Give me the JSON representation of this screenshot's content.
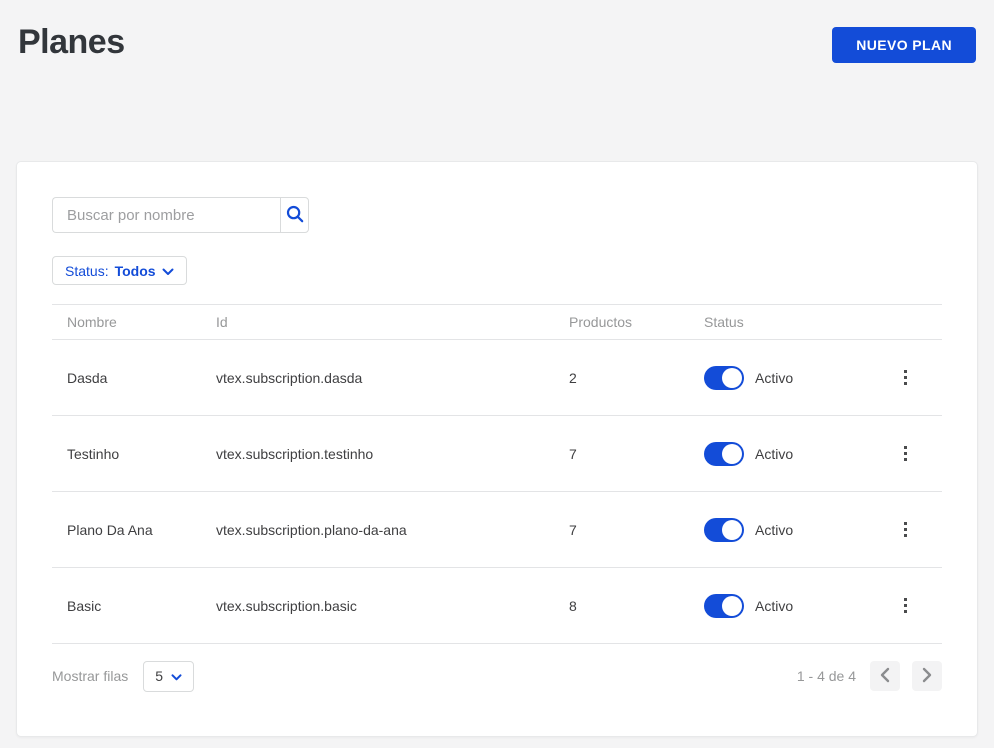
{
  "page": {
    "title": "Planes"
  },
  "header": {
    "new_plan_button": "NUEVO PLAN"
  },
  "toolbar": {
    "search": {
      "placeholder": "Buscar por nombre"
    },
    "status_filter": {
      "label": "Status:",
      "value": "Todos"
    }
  },
  "table": {
    "columns": [
      "Nombre",
      "Id",
      "Productos",
      "Status"
    ],
    "rows": [
      {
        "nombre": "Dasda",
        "id": "vtex.subscription.dasda",
        "productos": "2",
        "status_label": "Activo",
        "active": true
      },
      {
        "nombre": "Testinho",
        "id": "vtex.subscription.testinho",
        "productos": "7",
        "status_label": "Activo",
        "active": true
      },
      {
        "nombre": "Plano Da Ana",
        "id": "vtex.subscription.plano-da-ana",
        "productos": "7",
        "status_label": "Activo",
        "active": true
      },
      {
        "nombre": "Basic",
        "id": "vtex.subscription.basic",
        "productos": "8",
        "status_label": "Activo",
        "active": true
      }
    ]
  },
  "footer": {
    "rows_label": "Mostrar filas",
    "rows_per_page": "5",
    "range_text": "1 - 4 de 4"
  },
  "icons": {
    "search": "magnifier-icon",
    "filter_caret": "chevron-down-icon",
    "row_menu": "kebab-menu-icon",
    "prev": "chevron-left-icon",
    "next": "chevron-right-icon"
  },
  "colors": {
    "accent": "#134cd8",
    "title_text": "#32363b",
    "body_text": "#3f3f41",
    "muted_text": "#979899",
    "divider": "#e3e4e6",
    "page_background": "#f4f4f5",
    "card_background": "#ffffff",
    "toggle_on": "#134cd8"
  }
}
